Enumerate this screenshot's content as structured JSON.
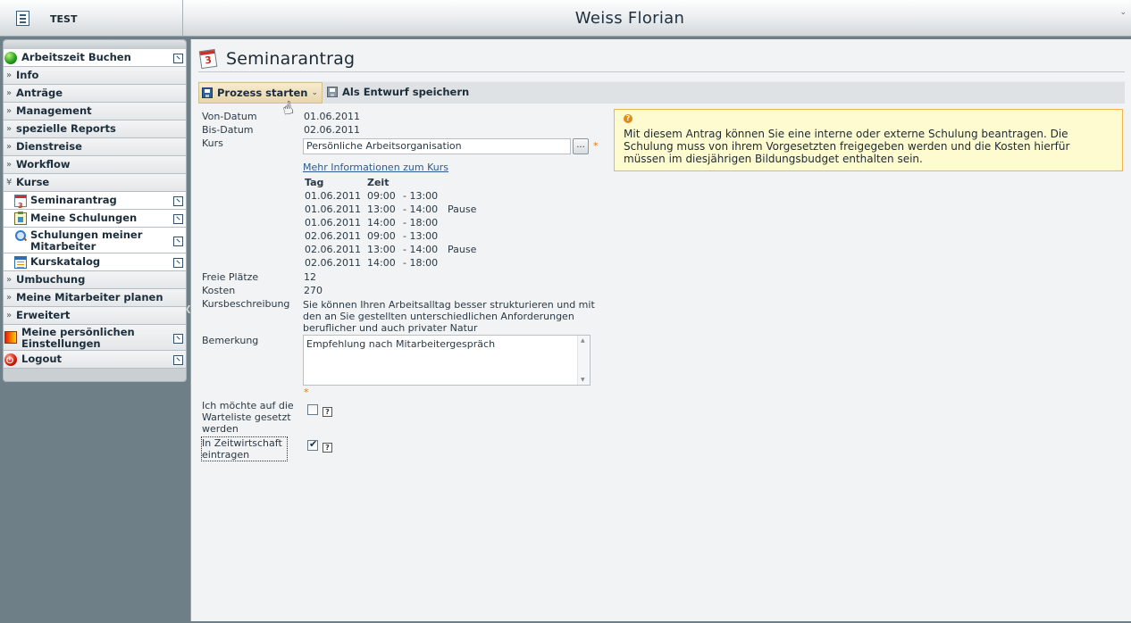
{
  "topbar": {
    "system": "TEST",
    "user": "Weiss Florian",
    "collapse": "⌄"
  },
  "sidebar": {
    "items": [
      {
        "label": "Arbeitszeit Buchen"
      },
      {
        "label": "Info"
      },
      {
        "label": "Anträge"
      },
      {
        "label": "Management"
      },
      {
        "label": "spezielle Reports"
      },
      {
        "label": "Dienstreise"
      },
      {
        "label": "Workflow"
      },
      {
        "label": "Kurse"
      },
      {
        "label": "Seminarantrag"
      },
      {
        "label": "Meine Schulungen"
      },
      {
        "label": "Schulungen meiner Mitarbeiter"
      },
      {
        "label": "Kurskatalog"
      },
      {
        "label": "Umbuchung"
      },
      {
        "label": "Meine Mitarbeiter planen"
      },
      {
        "label": "Erweitert"
      },
      {
        "label": "Meine persönlichen Einstellungen"
      },
      {
        "label": "Logout"
      }
    ]
  },
  "page": {
    "title": "Seminarantrag"
  },
  "toolbar": {
    "start_label": "Prozess starten",
    "draft_label": "Als Entwurf speichern"
  },
  "form": {
    "von_label": "Von-Datum",
    "von_value": "01.06.2011",
    "bis_label": "Bis-Datum",
    "bis_value": "02.06.2011",
    "kurs_label": "Kurs",
    "kurs_value": "Persönliche Arbeitsorganisation",
    "kurs_button": "...",
    "required_mark": "*",
    "more_info_link": "Mehr Informationen zum Kurs",
    "schedule_headers": {
      "day": "Tag",
      "time": "Zeit"
    },
    "schedule": [
      {
        "day": "01.06.2011",
        "from": "09:00",
        "to": "- 13:00",
        "note": ""
      },
      {
        "day": "01.06.2011",
        "from": "13:00",
        "to": "- 14:00",
        "note": "Pause"
      },
      {
        "day": "01.06.2011",
        "from": "14:00",
        "to": "- 18:00",
        "note": ""
      },
      {
        "day": "02.06.2011",
        "from": "09:00",
        "to": "- 13:00",
        "note": ""
      },
      {
        "day": "02.06.2011",
        "from": "13:00",
        "to": "- 14:00",
        "note": "Pause"
      },
      {
        "day": "02.06.2011",
        "from": "14:00",
        "to": "- 18:00",
        "note": ""
      }
    ],
    "plaetze_label": "Freie Plätze",
    "plaetze_value": "12",
    "kosten_label": "Kosten",
    "kosten_value": "270",
    "beschreibung_label": "Kursbeschreibung",
    "beschreibung_value": "Sie können Ihren Arbeitsalltag besser strukturieren und mit den an Sie gestellten unterschiedlichen Anforderungen beruflicher und auch privater Natur",
    "bemerkung_label": "Bemerkung",
    "bemerkung_value": "Empfehlung nach Mitarbeitergespräch",
    "warteliste_label": "Ich möchte auf die Warteliste gesetzt werden",
    "warteliste_checked": false,
    "zeitwirtschaft_label": "In Zeitwirtschaft eintragen",
    "zeitwirtschaft_checked": true,
    "help": "?"
  },
  "info": {
    "icon": "?",
    "text": "Mit diesem Antrag können Sie eine interne oder externe Schulung beantragen. Die Schulung muss von ihrem Vorgesetzten freigegeben werden und die Kosten hierfür müssen im diesjährigen Bildungsbudget enthalten sein."
  }
}
